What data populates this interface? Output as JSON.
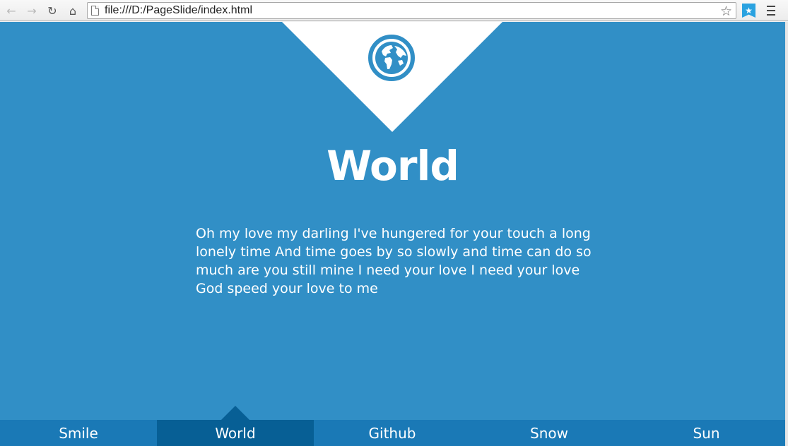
{
  "browser": {
    "url": "file:///D:/PageSlide/index.html",
    "icons": {
      "back": "back-arrow-icon",
      "forward": "forward-arrow-icon",
      "reload": "reload-icon",
      "home": "home-icon",
      "bookmark": "star-icon",
      "extension": "bookmark-extension-icon",
      "menu": "menu-icon"
    }
  },
  "slide": {
    "icon": "globe-icon",
    "title": "World",
    "text": "Oh my love my darling I've hungered for your touch a long lonely time And time goes by so slowly and time can do so much are you still mine I need your love I need your love God speed your love to me"
  },
  "nav": {
    "items": [
      {
        "label": "Smile"
      },
      {
        "label": "World"
      },
      {
        "label": "Github"
      },
      {
        "label": "Snow"
      },
      {
        "label": "Sun"
      }
    ],
    "active_index": 1
  },
  "colors": {
    "background": "#318fc6",
    "nav_bar": "#1a79b6",
    "nav_active": "#075f95",
    "text": "#ffffff"
  }
}
